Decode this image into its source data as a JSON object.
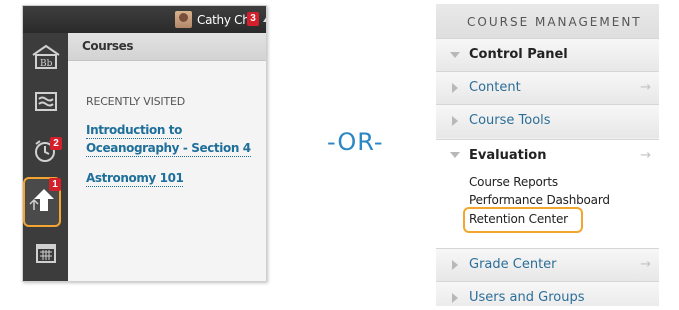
{
  "left": {
    "user_name": "Cathy Chu",
    "notification_count": "3",
    "courses_title": "Courses",
    "recently_visited": "RECENTLY VISITED",
    "course_1_line1": "Introduction to",
    "course_1_line2": "Oceanography - Section 4",
    "course_2": "Astronomy 101",
    "rail_badges": {
      "due_dates": "2",
      "activity": "1"
    },
    "rail_icons": [
      "blackboard-logo-icon",
      "stream-icon",
      "due-dates-clock-icon",
      "activity-stream-icon",
      "calendar-icon"
    ]
  },
  "separator_text": "-OR-",
  "right": {
    "header": "COURSE MANAGEMENT",
    "control_panel": "Control Panel",
    "items": {
      "content": "Content",
      "course_tools": "Course Tools",
      "evaluation": "Evaluation",
      "grade_center": "Grade Center",
      "users_and_groups": "Users and Groups"
    },
    "evaluation_subitems": {
      "course_reports": "Course Reports",
      "performance_dashboard": "Performance Dashboard",
      "retention_center": "Retention Center"
    },
    "arrow_glyph": "→"
  },
  "colors": {
    "highlight": "#f3a530",
    "badge": "#d4202b",
    "link": "#1e6f9a",
    "or_text": "#2a86c4"
  }
}
